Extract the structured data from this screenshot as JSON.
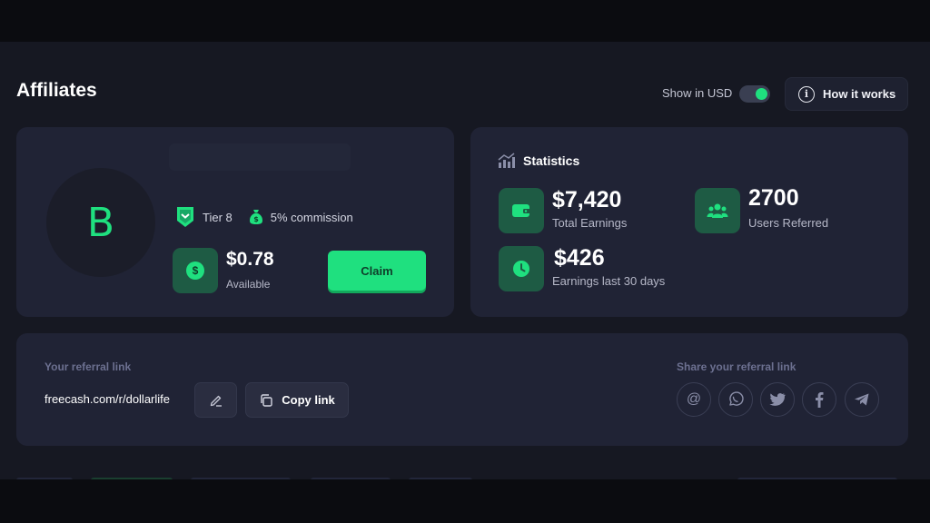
{
  "header": {
    "title": "Affiliates",
    "show_usd_label": "Show in USD",
    "show_usd_on": true,
    "how_it_works_label": "How it works"
  },
  "user_card": {
    "avatar_letter": "B",
    "tier": "Tier 8",
    "commission": "5% commission",
    "available_amount": "$0.78",
    "available_label": "Available",
    "claim_label": "Claim"
  },
  "stats": {
    "title": "Statistics",
    "total_earnings_value": "$7,420",
    "total_earnings_label": "Total Earnings",
    "users_referred_value": "2700",
    "users_referred_label": "Users Referred",
    "last30_value": "$426",
    "last30_label": "Earnings last 30 days"
  },
  "referral": {
    "label": "Your referral link",
    "url": "freecash.com/r/dollarlife",
    "copy_label": "Copy link",
    "share_label": "Share your referral link",
    "share_targets": [
      "email",
      "whatsapp",
      "twitter",
      "facebook",
      "telegram"
    ]
  },
  "colors": {
    "accent": "#1fe07f",
    "card_bg": "#202335",
    "page_bg": "#161822",
    "icon_tile": "#1e5b44"
  }
}
